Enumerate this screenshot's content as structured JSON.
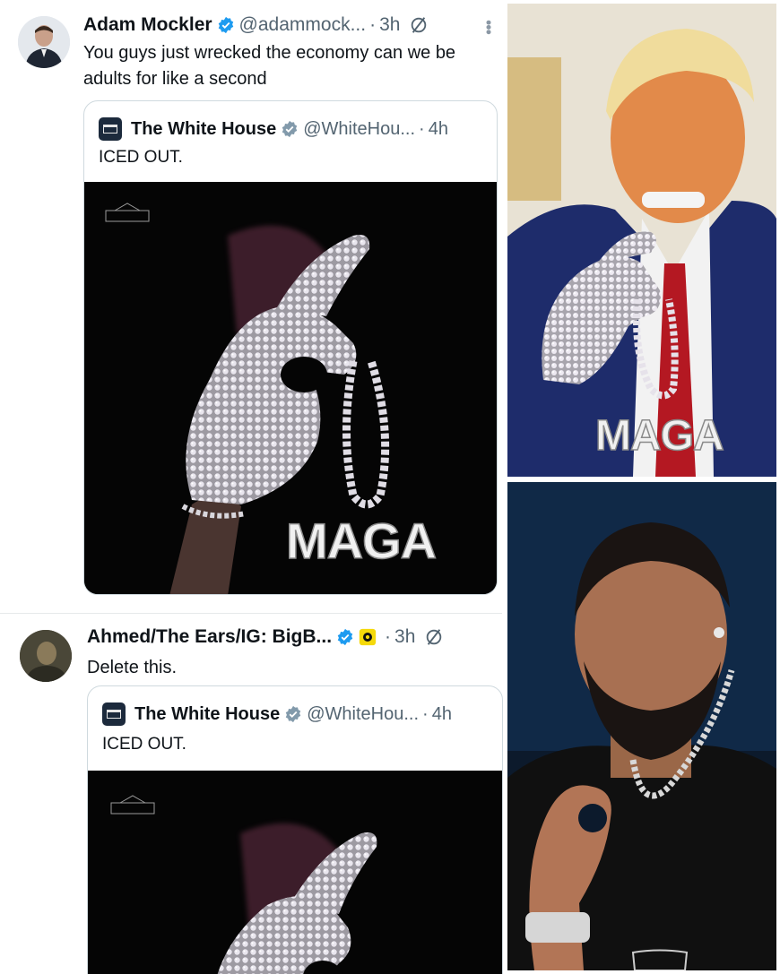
{
  "tweets": [
    {
      "author_name": "Adam Mockler",
      "handle": "@adammock...",
      "separator": "·",
      "time": "3h",
      "text_line1": "You guys just wrecked the economy can we be",
      "text_line2": "adults for like a second",
      "quote": {
        "author_name": "The White House",
        "handle": "@WhiteHou...",
        "separator": "·",
        "time": "4h",
        "text": "ICED OUT.",
        "media_caption": "MAGA"
      }
    },
    {
      "author_name": "Ahmed/The Ears/IG: BigB...",
      "handle": "",
      "separator": "·",
      "time": "3h",
      "text_line1": "Delete this.",
      "quote": {
        "author_name": "The White House",
        "handle": "@WhiteHou...",
        "separator": "·",
        "time": "4h",
        "text": "ICED OUT."
      }
    }
  ],
  "photos": {
    "trump_chain_text": "MAGA"
  },
  "icons": {
    "verified": "verified-badge-icon",
    "grok": "grok-icon",
    "more": "more-options-icon",
    "government_badge": "gray-government-badge-icon"
  },
  "colors": {
    "verified_blue": "#1d9bf0",
    "gov_gray": "#829aab",
    "muted_text": "#536471",
    "border": "#cfd9de"
  }
}
